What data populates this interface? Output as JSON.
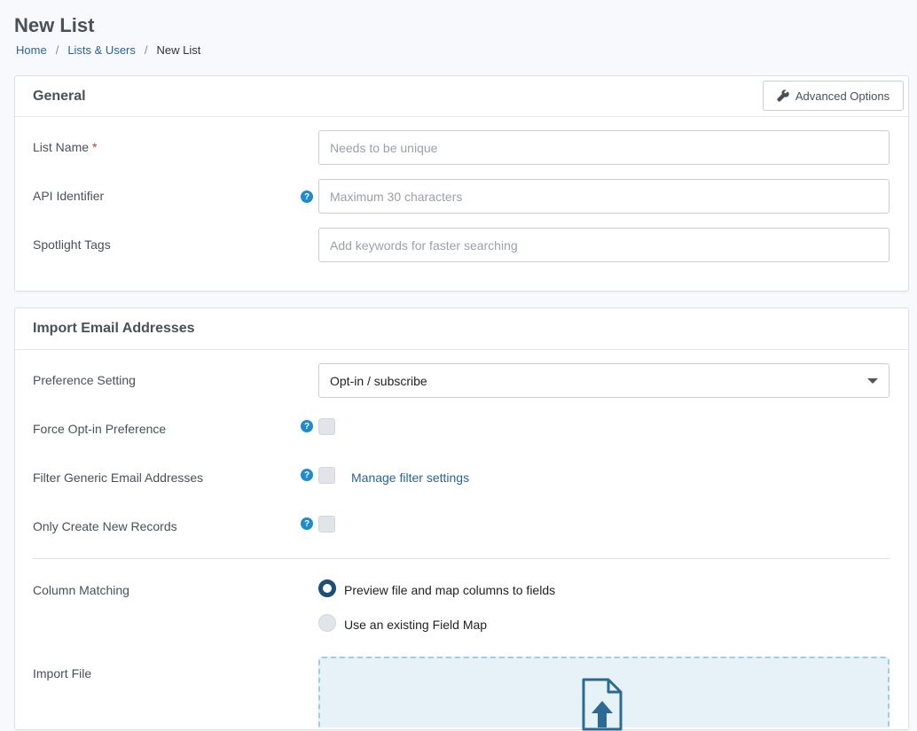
{
  "page": {
    "title": "New List",
    "breadcrumb": [
      "Home",
      "Lists & Users",
      "New List"
    ]
  },
  "general": {
    "title": "General",
    "advanced_label": "Advanced Options",
    "fields": {
      "list_name": {
        "label": "List Name",
        "required_mark": "*",
        "placeholder": "Needs to be unique",
        "value": ""
      },
      "api_identifier": {
        "label": "API Identifier",
        "placeholder": "Maximum 30 characters",
        "value": ""
      },
      "spotlight_tags": {
        "label": "Spotlight Tags",
        "placeholder": "Add keywords for faster searching",
        "value": ""
      }
    }
  },
  "import": {
    "title": "Import Email Addresses",
    "preference_setting": {
      "label": "Preference Setting",
      "value": "Opt-in / subscribe"
    },
    "force_optin": {
      "label": "Force Opt-in Preference",
      "checked": false
    },
    "filter_generic": {
      "label": "Filter Generic Email Addresses",
      "checked": false,
      "link": "Manage filter settings"
    },
    "only_new": {
      "label": "Only Create New Records",
      "checked": false
    },
    "column_matching": {
      "label": "Column Matching",
      "options": [
        "Preview file and map columns to fields",
        "Use an existing Field Map"
      ],
      "selected": "Preview file and map columns to fields"
    },
    "import_file": {
      "label": "Import File"
    }
  },
  "colors": {
    "accent": "#1b4e7a",
    "link": "#2a6496",
    "help": "#1d8bd0",
    "required": "#c0392b",
    "dropzone_bg": "#e6f2f8"
  },
  "icons": {
    "advanced": "wrench-icon",
    "help": "question-circle-icon",
    "upload": "file-upload-icon",
    "select": "caret-down-icon"
  }
}
